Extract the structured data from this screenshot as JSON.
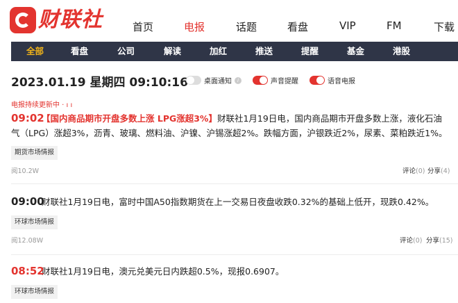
{
  "header": {
    "logo_text": "财联社",
    "nav": [
      {
        "label": "首页"
      },
      {
        "label": "电报",
        "active": true
      },
      {
        "label": "话题"
      },
      {
        "label": "看盘"
      },
      {
        "label": "VIP"
      },
      {
        "label": "FM"
      },
      {
        "label": "下载"
      }
    ]
  },
  "subnav": [
    {
      "label": "全部",
      "active": true
    },
    {
      "label": "看盘"
    },
    {
      "label": "公司"
    },
    {
      "label": "解读"
    },
    {
      "label": "加红"
    },
    {
      "label": "推送"
    },
    {
      "label": "提醒"
    },
    {
      "label": "基金"
    },
    {
      "label": "港股"
    }
  ],
  "datetime": "2023.01.19 星期四 09:10:16",
  "toggles": {
    "desktop_notify": {
      "label": "桌面通知",
      "on": false
    },
    "sound_alert": {
      "label": "声音提醒",
      "on": true
    },
    "voice_telegraph": {
      "label": "语音电报",
      "on": true
    }
  },
  "info_glyph": "i",
  "update_status": "电报持续更新中 · ı ı",
  "news": [
    {
      "time": "09:02",
      "title": "【国内商品期市开盘多数上涨 LPG涨超3%】",
      "text": "财联社1月19日电，国内商品期市开盘多数上涨，液化石油气（LPG）涨超3%，沥青、玻璃、燃料油、沪镍、沪锡涨超2%。跌幅方面，沪银跌近2%，尿素、菜粕跌近1%。",
      "tag": "期货市场情报",
      "reads": "阅10.2W",
      "comment_label": "评论",
      "comment_count": "(0)",
      "share_label": "分享",
      "share_count": "(4)"
    },
    {
      "time": "09:00",
      "title": "",
      "text": "财联社1月19日电，富时中国A50指数期货在上一交易日夜盘收跌0.32%的基础上低开，现跌0.42%。",
      "tag": "环球市场情报",
      "reads": "阅12.08W",
      "comment_label": "评论",
      "comment_count": "(0)",
      "share_label": "分享",
      "share_count": "(15)"
    },
    {
      "time": "08:52",
      "title": "",
      "text": "财联社1月19日电，澳元兑美元日内跌超0.5%，现报0.6907。",
      "tag": "环球市场情报"
    }
  ],
  "colors": {
    "brand_red": "#e3342f",
    "subnav_bg": "#2f3547",
    "subnav_active": "#f0b31a"
  }
}
